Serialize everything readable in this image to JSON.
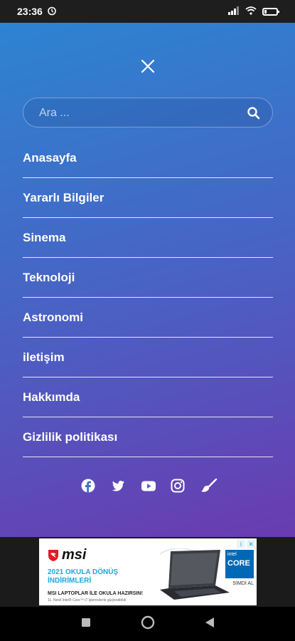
{
  "status_bar": {
    "time": "23:36",
    "battery_level": 0.2
  },
  "search": {
    "placeholder": "Ara ..."
  },
  "nav": {
    "items": [
      {
        "label": "Anasayfa"
      },
      {
        "label": "Yararlı Bilgiler"
      },
      {
        "label": "Sinema"
      },
      {
        "label": "Teknoloji"
      },
      {
        "label": "Astronomi"
      },
      {
        "label": "iletişim"
      },
      {
        "label": "Hakkımda"
      },
      {
        "label": "Gizlilik politikası"
      }
    ]
  },
  "social": [
    "facebook-icon",
    "twitter-icon",
    "youtube-icon",
    "instagram-icon",
    "brush-icon"
  ],
  "ad": {
    "brand": "msi",
    "headline_1": "2021 OKULA DÖNÜŞ",
    "headline_2": "İNDİRİMLERİ",
    "subline": "MSI LAPTOPLAR İLE OKULA HAZIRSIN!",
    "fine_print": "11. Nesil Intel® Core™ i7 İşlemcilerle güçlendirildi",
    "intel_top": "intel",
    "intel_core": "CORE",
    "cta": "SİMDİ AL"
  },
  "colors": {
    "gradient_top": "#2c84d2",
    "gradient_bottom": "#6a3bb0",
    "ad_accent": "#1aa7d9"
  }
}
